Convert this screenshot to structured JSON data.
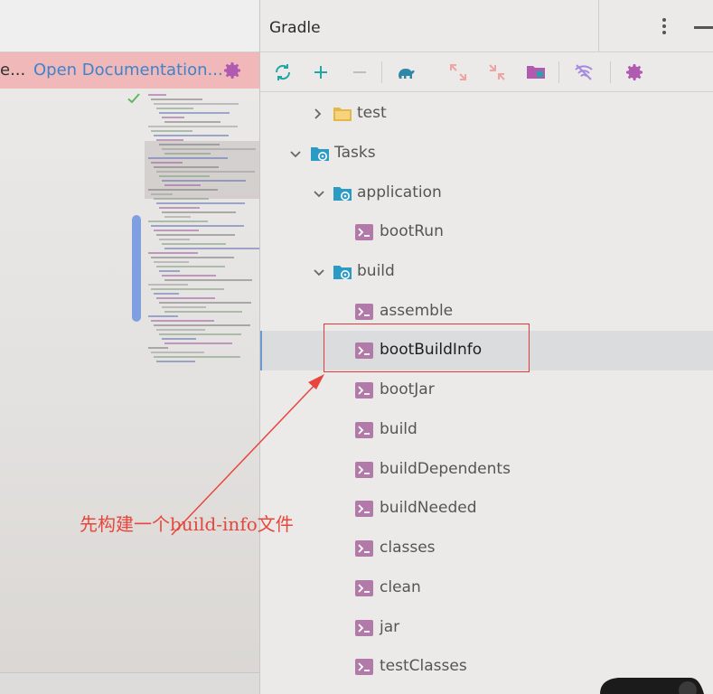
{
  "notification": {
    "tail_text": "e...",
    "link_label": "Open Documentation..."
  },
  "gradle": {
    "title": "Gradle",
    "toolbar": [
      {
        "name": "refresh-icon",
        "color": "#22a7a7"
      },
      {
        "name": "add-icon",
        "color": "#22a7a7"
      },
      {
        "name": "remove-icon",
        "color": "#bdbdbd"
      },
      {
        "name": "elephant-icon",
        "color": "#2f86a6"
      },
      {
        "name": "expand-all-icon",
        "color": "#f0a3a3"
      },
      {
        "name": "collapse-all-icon",
        "color": "#f0a3a3"
      },
      {
        "name": "dependencies-icon",
        "color": "#b05ab0"
      },
      {
        "name": "toggle-offline-icon",
        "color": "#a78ae0"
      },
      {
        "name": "settings-icon",
        "color": "#b05ab0"
      }
    ],
    "tree": [
      {
        "label": "test",
        "kind": "folder",
        "state": "collapsed"
      },
      {
        "label": "Tasks",
        "kind": "gear-folder",
        "state": "expanded"
      },
      {
        "label": "application",
        "kind": "gear-folder",
        "state": "expanded"
      },
      {
        "label": "bootRun",
        "kind": "task"
      },
      {
        "label": "build",
        "kind": "gear-folder",
        "state": "expanded"
      },
      {
        "label": "assemble",
        "kind": "task"
      },
      {
        "label": "bootBuildInfo",
        "kind": "task",
        "selected": true
      },
      {
        "label": "bootJar",
        "kind": "task"
      },
      {
        "label": "build",
        "kind": "task"
      },
      {
        "label": "buildDependents",
        "kind": "task"
      },
      {
        "label": "buildNeeded",
        "kind": "task"
      },
      {
        "label": "classes",
        "kind": "task"
      },
      {
        "label": "clean",
        "kind": "task"
      },
      {
        "label": "jar",
        "kind": "task"
      },
      {
        "label": "testClasses",
        "kind": "task"
      }
    ]
  },
  "annotation": {
    "text": "先构建一个build-info文件",
    "color": "#e8463c"
  },
  "colors": {
    "task_icon": "#b27aa8",
    "folder_icon": "#2a9bc4",
    "gear_icon": "#2a9bc4",
    "link": "#3f83cc",
    "notification_bg": "#f0b8b8",
    "selection_bar": "#6b9bd2"
  }
}
